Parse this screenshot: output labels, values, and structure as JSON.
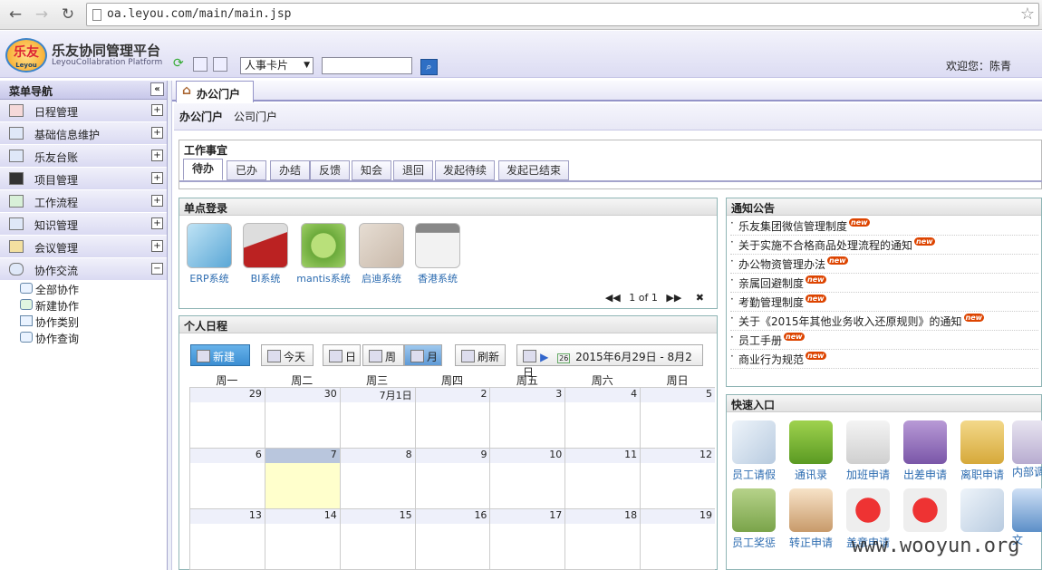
{
  "browser": {
    "url": "oa.leyou.com/main/main.jsp"
  },
  "header": {
    "logo_text": "乐友",
    "logo_sub": "Leyou",
    "brand": "乐友协同管理平台",
    "brand_en": "LeyouCollabration Platform",
    "select_value": "人事卡片",
    "welcome": "欢迎您：陈青"
  },
  "sidebar": {
    "title": "菜单导航",
    "items": [
      {
        "label": "日程管理",
        "expanded": false
      },
      {
        "label": "基础信息维护",
        "expanded": false
      },
      {
        "label": "乐友台账",
        "expanded": false
      },
      {
        "label": "项目管理",
        "expanded": false
      },
      {
        "label": "工作流程",
        "expanded": false
      },
      {
        "label": "知识管理",
        "expanded": false
      },
      {
        "label": "会议管理",
        "expanded": false
      },
      {
        "label": "协作交流",
        "expanded": true
      }
    ],
    "subitems": [
      "全部协作",
      "新建协作",
      "协作类别",
      "协作查询"
    ]
  },
  "tabs": {
    "main": "办公门户"
  },
  "breadcrumb": {
    "current": "办公门户",
    "link": "公司门户"
  },
  "work": {
    "title": "工作事宜",
    "tabs": [
      "待办",
      "已办",
      "办结",
      "反馈",
      "知会",
      "退回",
      "发起待续",
      "发起已结束"
    ]
  },
  "sso": {
    "title": "单点登录",
    "apps": [
      "ERP系统",
      "BI系统",
      "mantis系统",
      "启迪系统",
      "香港系统"
    ],
    "pager": "1 of 1"
  },
  "notice": {
    "title": "通知公告",
    "badge": "new",
    "items": [
      "乐友集团微信管理制度",
      "关于实施不合格商品处理流程的通知",
      "办公物资管理办法",
      "亲属回避制度",
      "考勤管理制度",
      "关于《2015年其他业务收入还原规则》的通知",
      "员工手册",
      "商业行为规范"
    ]
  },
  "schedule": {
    "title": "个人日程",
    "buttons": {
      "new": "新建",
      "today": "今天",
      "day": "日",
      "week": "周",
      "month": "月",
      "refresh": "刷新"
    },
    "range": "2015年6月29日 - 8月2日",
    "cal_icon_day": "26",
    "weekdays": [
      "周一",
      "周二",
      "周三",
      "周四",
      "周五",
      "周六",
      "周日"
    ],
    "rows": [
      [
        "29",
        "30",
        "7月1日",
        "2",
        "3",
        "4",
        "5"
      ],
      [
        "6",
        "7",
        "8",
        "9",
        "10",
        "11",
        "12"
      ],
      [
        "13",
        "14",
        "15",
        "16",
        "17",
        "18",
        "19"
      ]
    ]
  },
  "quick": {
    "title": "快速入口",
    "row1": [
      "员工请假",
      "通讯录",
      "加班申请",
      "出差申请",
      "离职申请",
      "内部调"
    ],
    "row2": [
      "员工奖惩",
      "转正申请",
      "盖章申请",
      "",
      "",
      "文"
    ]
  },
  "watermark": "www.wooyun.org",
  "colors": {
    "accent": "#9494c8",
    "link": "#2b6bb0",
    "today": "#ffffcc"
  }
}
